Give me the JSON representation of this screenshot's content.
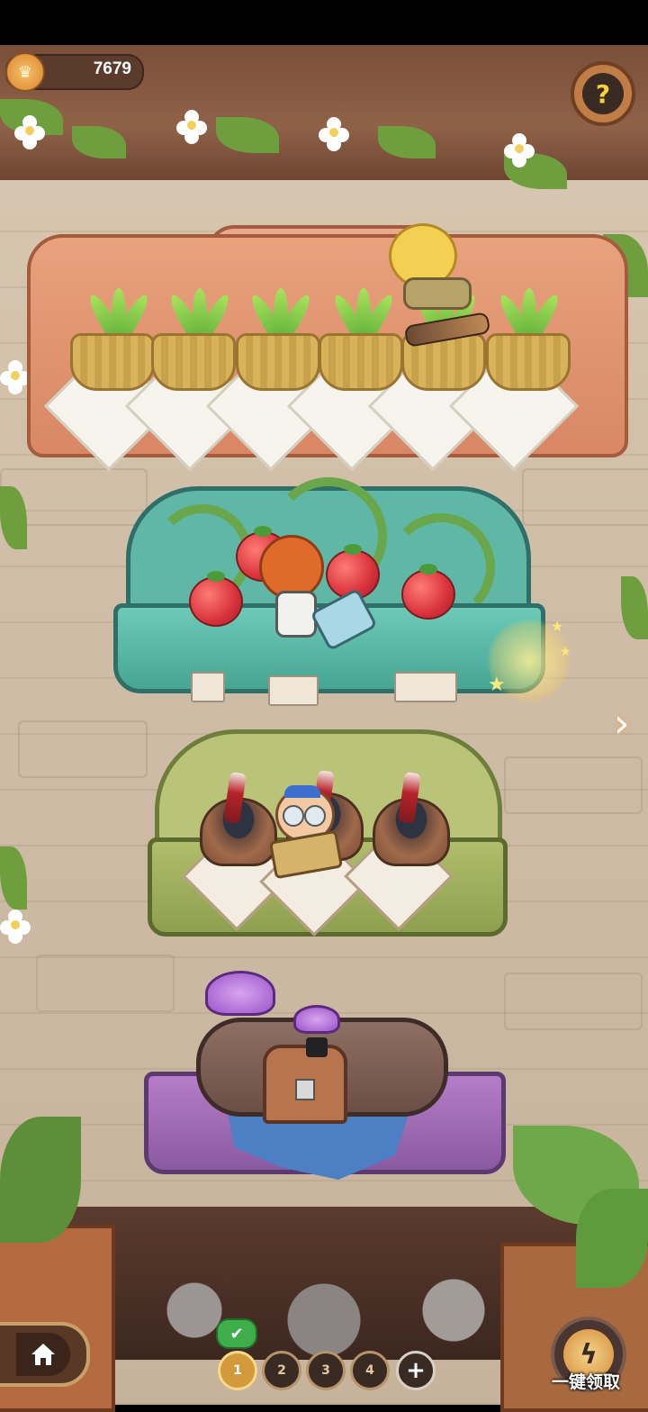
{
  "currency": {
    "icon": "coin-crown-icon",
    "value": "7679"
  },
  "help": {
    "icon": "question-mark-icon",
    "symbol": "?"
  },
  "shelves": [
    {
      "id": "basket-shelf",
      "items": [
        "plant-sprout",
        "plant-sprout",
        "plant-sprout",
        "plant-sprout",
        "plant-sprout",
        "plant-sprout"
      ]
    },
    {
      "id": "tomato-cart",
      "items": [
        "tomato",
        "tomato",
        "tomato",
        "tomato"
      ]
    },
    {
      "id": "grill-station",
      "items": [
        "meat-pot",
        "meat-pot",
        "meat-pot"
      ]
    },
    {
      "id": "mushroom-log",
      "items": [
        "purple-mushroom",
        "treasure-chest"
      ]
    }
  ],
  "navigation": {
    "home_icon": "home-icon",
    "pages": [
      {
        "label": "1",
        "active": true
      },
      {
        "label": "2",
        "active": false
      },
      {
        "label": "3",
        "active": false
      },
      {
        "label": "4",
        "active": false
      }
    ],
    "add_symbol": "+",
    "check_symbol": "✔"
  },
  "collect": {
    "icon": "lightning-icon",
    "symbol": "ϟ",
    "label": "一键领取"
  },
  "next_arrow": "›"
}
